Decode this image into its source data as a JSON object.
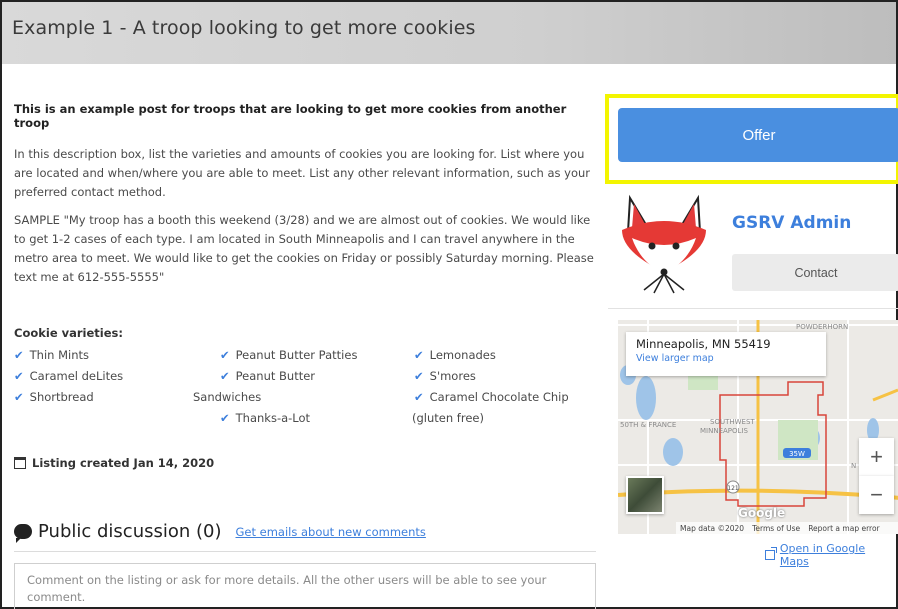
{
  "header": {
    "title": "Example 1 - A troop looking to get more cookies"
  },
  "description": {
    "lead": "This is an example post for troops that are looking to get more cookies from another troop",
    "p1": "In this description box, list the varieties and amounts of cookies you are looking for. List where you are located and when/where you are able to meet. List any other relevant information, such as your preferred contact method.",
    "p2": "SAMPLE \"My troop has a booth this weekend (3/28) and we are almost out of cookies. We would like to get 1-2 cases of each type. I am located in South Minneapolis and I can travel anywhere in the metro area to meet. We would like to get the cookies on Friday or possibly Saturday morning. Please text me at 612-555-5555\""
  },
  "varieties": {
    "title": "Cookie varieties:",
    "col1": [
      "Thin Mints",
      "Caramel deLites",
      "Shortbread"
    ],
    "col2a": [
      "Peanut Butter Patties",
      "Peanut Butter"
    ],
    "col2_wrap": "Sandwiches",
    "col2b": [
      "Thanks-a-Lot"
    ],
    "col3": [
      "Lemonades",
      "S'mores",
      "Caramel Chocolate Chip"
    ],
    "col3_wrap": "(gluten free)"
  },
  "listing": {
    "created": "Listing created Jan 14, 2020"
  },
  "discussion": {
    "title": "Public discussion (0)",
    "email_link": "Get emails about new comments",
    "comment_placeholder": "Comment on the listing or ask for more details. All the other users will be able to see your comment."
  },
  "sidebar": {
    "offer_label": "Offer",
    "author_name": "GSRV Admin",
    "contact_label": "Contact"
  },
  "map": {
    "address": "Minneapolis, MN 55419",
    "view_larger": "View larger map",
    "labels": {
      "powderhorn": "POWDERHORN",
      "southwest": "SOUTHWEST",
      "minneapolis": "MINNEAPOLIS",
      "france": "50TH & FRANCE",
      "i35w": "35W",
      "r121": "121",
      "n": "N"
    },
    "zoom_in": "+",
    "zoom_out": "−",
    "google": "Google",
    "footer": {
      "data": "Map data ©2020",
      "terms": "Terms of Use",
      "report": "Report a map error"
    },
    "open_link": "Open in Google Maps"
  },
  "colors": {
    "accent": "#3d7fdc",
    "offer_button": "#4a8fe0",
    "highlight": "#f3f500"
  }
}
